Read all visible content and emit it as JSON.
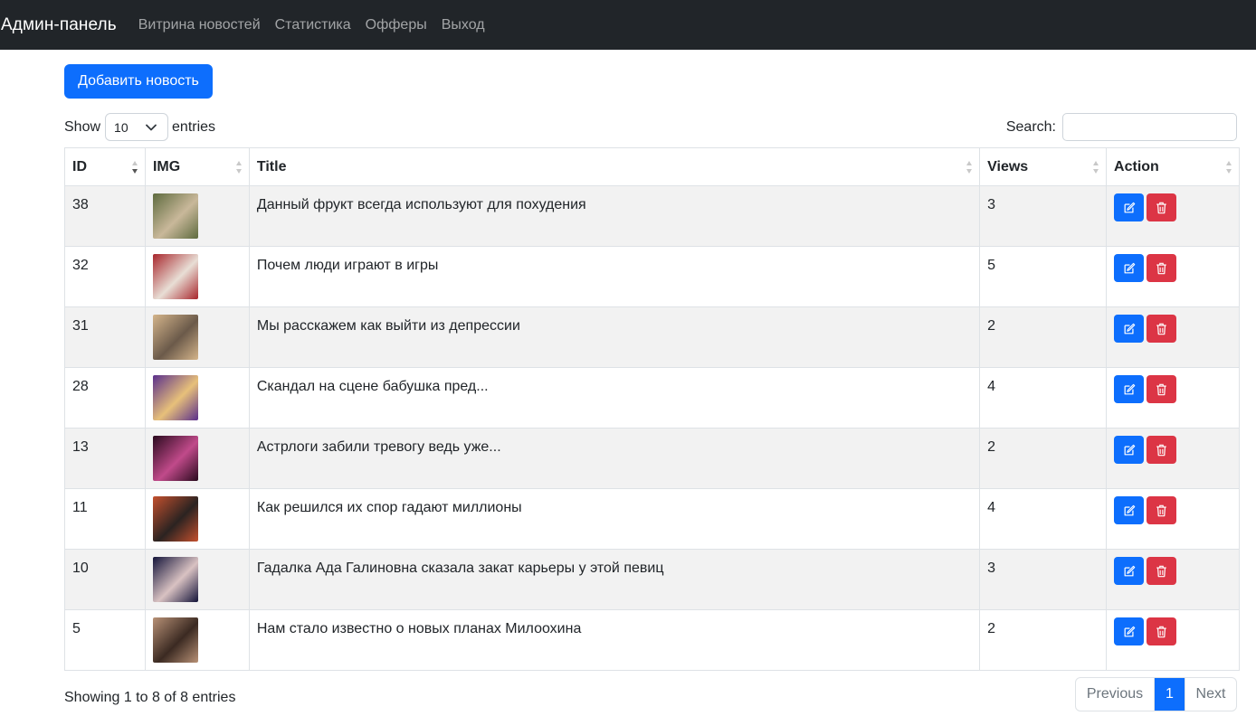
{
  "navbar": {
    "brand": "Админ-панель",
    "links": [
      "Витрина новостей",
      "Статистика",
      "Офферы",
      "Выход"
    ]
  },
  "toolbar": {
    "add_label": "Добавить новость"
  },
  "length_control": {
    "show_label": "Show",
    "value": "10",
    "entries_label": "entries"
  },
  "search": {
    "label": "Search:",
    "value": ""
  },
  "table": {
    "columns": [
      "ID",
      "IMG",
      "Title",
      "Views",
      "Action"
    ],
    "rows": [
      {
        "id": "38",
        "title": "Данный фрукт всегда используют для похудения",
        "views": "3",
        "thumb_colors": [
          "#5e6b3f",
          "#c9b89a"
        ]
      },
      {
        "id": "32",
        "title": "Почем люди играют в игры",
        "views": "5",
        "thumb_colors": [
          "#a8262c",
          "#e8ded5"
        ]
      },
      {
        "id": "31",
        "title": "Мы расскажем как выйти из депрессии",
        "views": "2",
        "thumb_colors": [
          "#d4b48a",
          "#6b5a4a"
        ]
      },
      {
        "id": "28",
        "title": "Скандал на сцене бабушка пред...",
        "views": "4",
        "thumb_colors": [
          "#5a2f8c",
          "#e7c07a"
        ]
      },
      {
        "id": "13",
        "title": "Астрлоги забили тревогу ведь уже...",
        "views": "2",
        "thumb_colors": [
          "#2a0a1e",
          "#c04a8a"
        ]
      },
      {
        "id": "11",
        "title": "Как решился их спор гадают миллионы",
        "views": "4",
        "thumb_colors": [
          "#c4502e",
          "#2b2321"
        ]
      },
      {
        "id": "10",
        "title": "Гадалка Ада Галиновна сказала закат карьеры у этой певиц",
        "views": "3",
        "thumb_colors": [
          "#14143a",
          "#d9c2c2"
        ]
      },
      {
        "id": "5",
        "title": "Нам стало известно о новых планах Милоохина",
        "views": "2",
        "thumb_colors": [
          "#b89176",
          "#3b2a22"
        ]
      }
    ]
  },
  "footer": {
    "info": "Showing 1 to 8 of 8 entries",
    "prev_label": "Previous",
    "current_page": "1",
    "next_label": "Next"
  },
  "colors": {
    "navbar_bg": "#212529",
    "primary": "#0d6efd",
    "danger": "#dc3545",
    "stripe": "#f2f2f2"
  },
  "icons": {
    "edit": "pencil-square-icon",
    "delete": "trash-icon",
    "sort": "sort-arrows-icon",
    "select": "chevron-down-icon"
  }
}
